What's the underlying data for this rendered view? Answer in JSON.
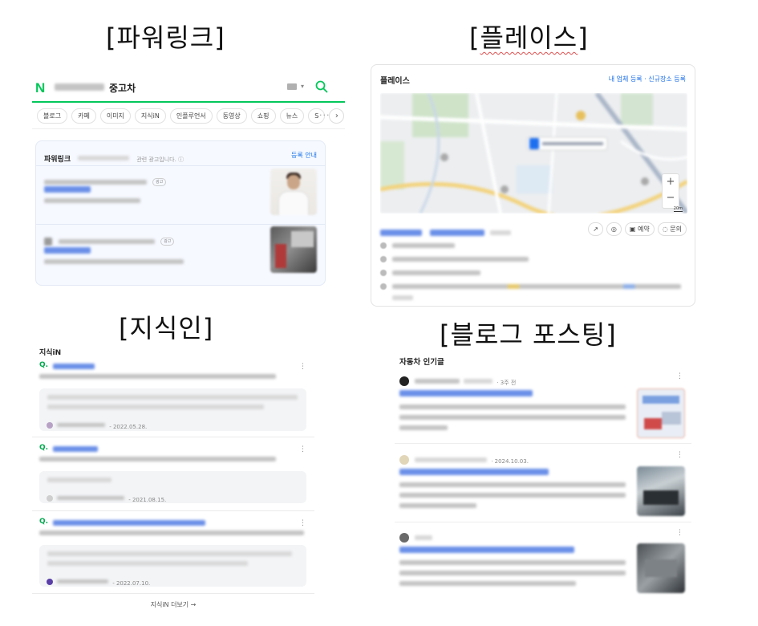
{
  "titles": {
    "powerlink": "[파워링크]",
    "place": "[플레이스]",
    "kin": "[지식인]",
    "blog": "[블로그 포스팅]"
  },
  "powerlink": {
    "logo": "N",
    "query_suffix": "중고차",
    "tabs": [
      "블로그",
      "카페",
      "이미지",
      "지식iN",
      "인플루언서",
      "동영상",
      "쇼핑",
      "뉴스",
      "S"
    ],
    "next_arrow": "›",
    "more_dots": "···",
    "ad_title": "파워링크",
    "ad_note": "관련 광고입니다. ⓘ",
    "ad_link": "등록 안내",
    "ad_badge": "광고"
  },
  "place": {
    "title": "플레이스",
    "links": "내 업체 등록 · 신규장소 등록",
    "zoom_in": "+",
    "zoom_out": "−",
    "scale": "20m",
    "btn_route": "↗",
    "btn_pin": "◎",
    "btn_reserve": "예약",
    "btn_inquiry": "문의"
  },
  "kin": {
    "title": "지식iN",
    "q_marker": "Q.",
    "more_icon": "⋮",
    "dates": [
      "- 2022.05.28.",
      "- 2021.08.15.",
      "- 2022.07.10."
    ],
    "more_link": "지식iN 더보기 →"
  },
  "blog": {
    "title": "자동차 인기글",
    "ago": "· 3주 전",
    "date2": "· 2024.10.03.",
    "more_icon": "⋮"
  },
  "colors": {
    "naver_green": "#03c75a",
    "link_blue": "#1a73e8"
  }
}
